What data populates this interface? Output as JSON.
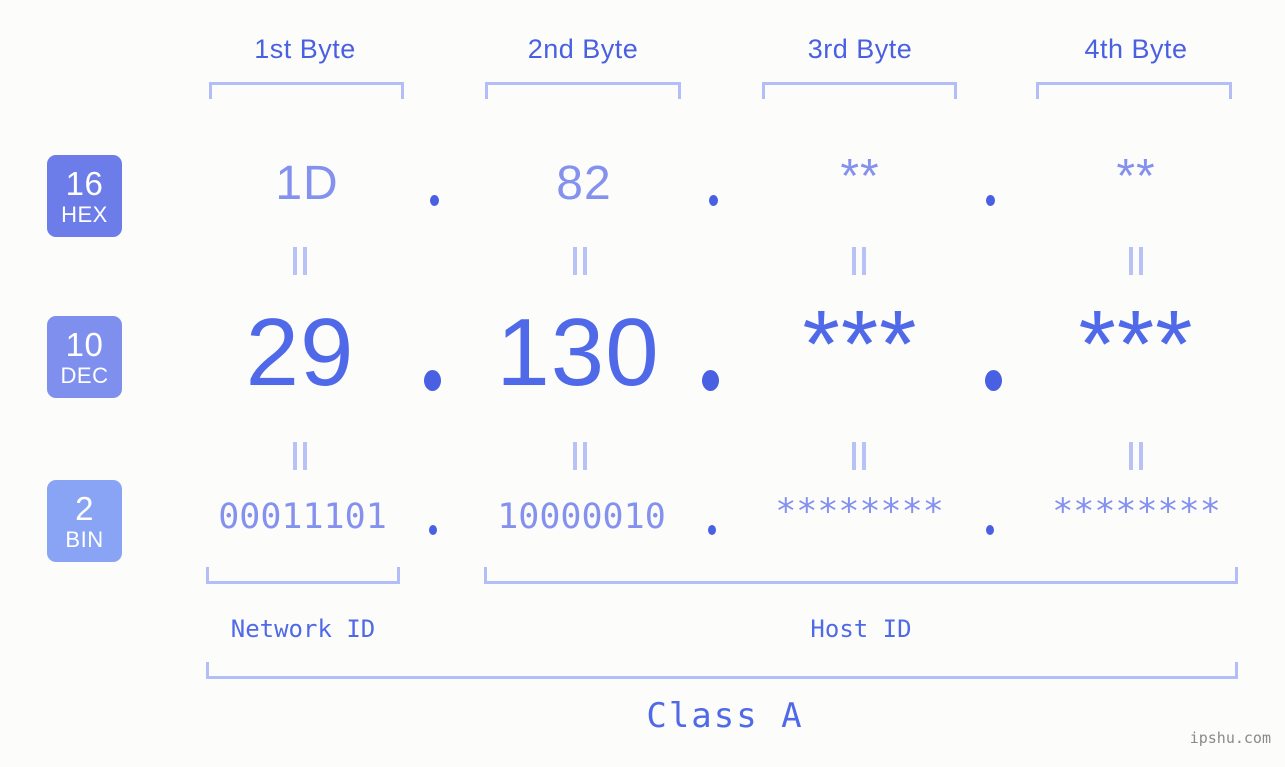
{
  "meta": {
    "background_color": "#fcfdfa",
    "accent_strong": "#4a60e2",
    "accent_mid": "#5069e8",
    "accent_light": "#8491ef",
    "bracket_color": "#b3bdf7"
  },
  "byte_headers": [
    {
      "label": "1st Byte"
    },
    {
      "label": "2nd Byte"
    },
    {
      "label": "3rd Byte"
    },
    {
      "label": "4th Byte"
    }
  ],
  "rows": [
    {
      "id": "hex",
      "badge_number": "16",
      "badge_label": "HEX",
      "badge_color": "#6c7ce9",
      "values": [
        "1D",
        "82",
        "**",
        "**"
      ],
      "separator": "."
    },
    {
      "id": "dec",
      "badge_number": "10",
      "badge_label": "DEC",
      "badge_color": "#7f8fee",
      "values": [
        "29",
        "130",
        "***",
        "***"
      ],
      "separator": "."
    },
    {
      "id": "bin",
      "badge_number": "2",
      "badge_label": "BIN",
      "badge_color": "#8aa4f5",
      "values": [
        "00011101",
        "10000010",
        "********",
        "********"
      ],
      "separator": "."
    }
  ],
  "equals_marks": {
    "glyph": "=",
    "count_per_gap": 4,
    "gaps": 2
  },
  "id_sections": [
    {
      "label": "Network ID"
    },
    {
      "label": "Host ID"
    }
  ],
  "class_section": {
    "label": "Class A"
  },
  "watermark": {
    "text": "ipshu.com"
  }
}
